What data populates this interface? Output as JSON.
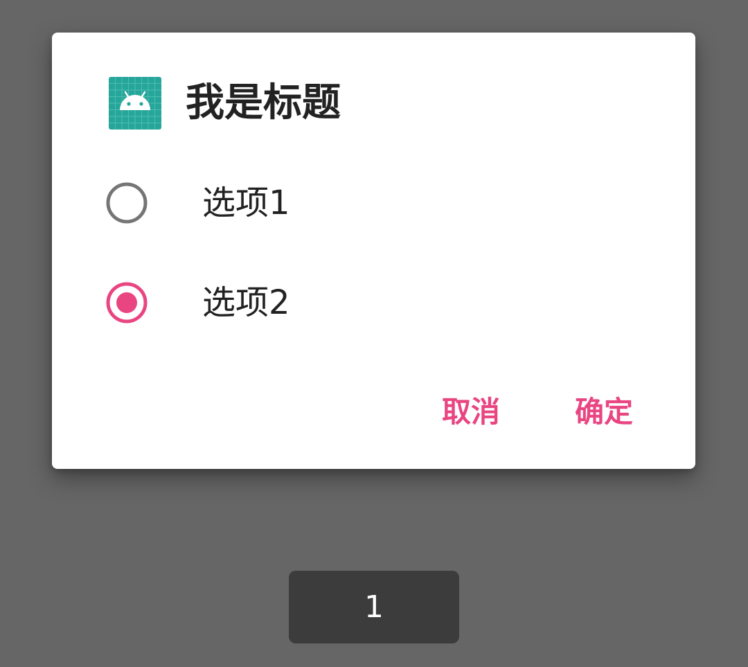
{
  "dialog": {
    "title": "我是标题",
    "icon": "android-app-icon",
    "options": [
      {
        "label": "选项1",
        "selected": false
      },
      {
        "label": "选项2",
        "selected": true
      }
    ],
    "buttons": {
      "cancel_label": "取消",
      "ok_label": "确定"
    }
  },
  "toast": {
    "text": "1"
  },
  "colors": {
    "accent": "#e94581",
    "scrim": "#666666",
    "toast_bg": "#3c3c3c",
    "icon_bg": "#26a69a"
  }
}
